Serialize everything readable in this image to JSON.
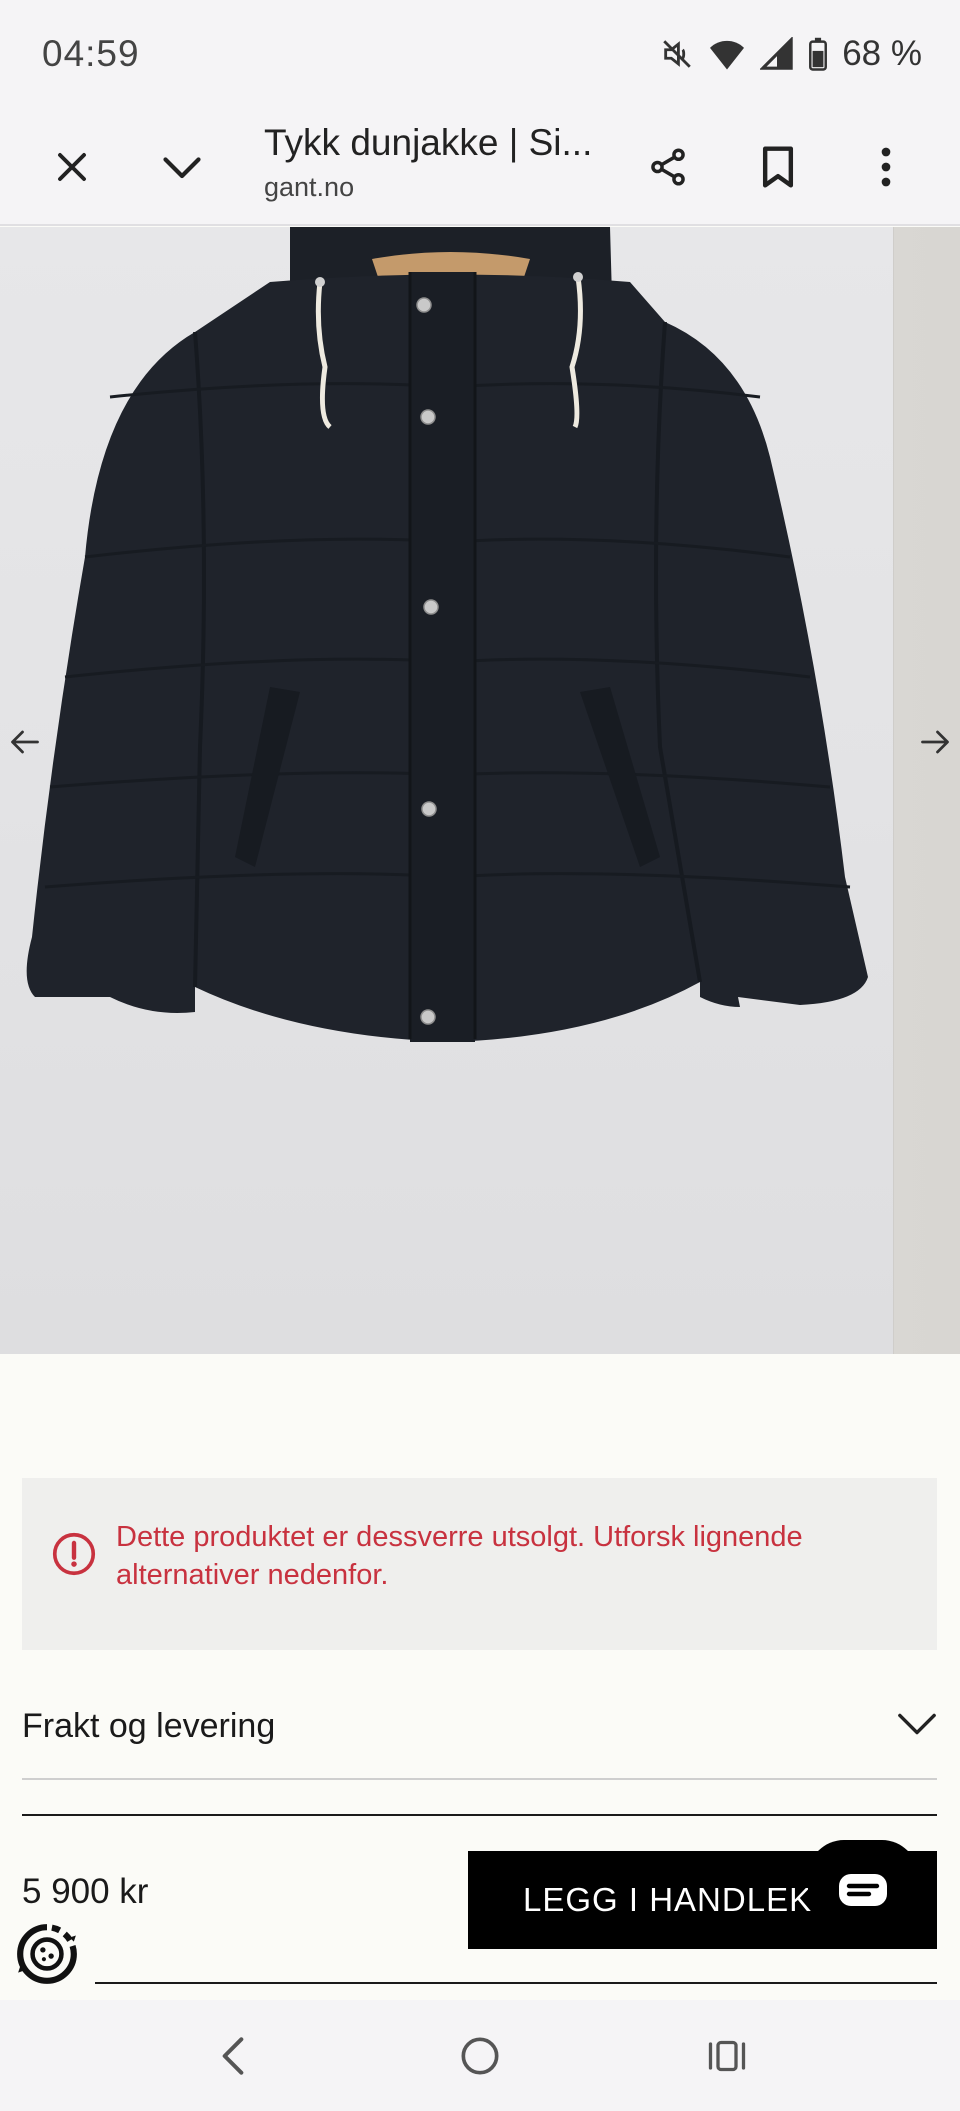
{
  "status_bar": {
    "time": "04:59",
    "battery": "68 %",
    "icons": [
      "mute-icon",
      "wifi-icon",
      "signal-icon",
      "battery-icon"
    ]
  },
  "toolbar": {
    "title": "Tykk dunjakke | Si...",
    "url": "gant.no",
    "icons": [
      "close-icon",
      "chevron-down-icon",
      "share-icon",
      "bookmark-icon",
      "more-icon"
    ]
  },
  "gallery": {
    "image_alt": "Tykk dunjakke",
    "prev_icon": "arrow-left-icon",
    "next_icon": "arrow-right-icon"
  },
  "notice": {
    "message": "Dette produktet er dessverre utsolgt. Utforsk lignende alternativer nedenfor.",
    "icon": "alert-icon",
    "color": "#c8323f"
  },
  "accordion": {
    "label": "Frakt og levering"
  },
  "buy": {
    "price": "5 900 kr",
    "button_label": "LEGG I HANDLEKURV",
    "chat_icon": "chat-icon",
    "cookie_icon": "cookie-settings-icon"
  },
  "navbar": {
    "icons": [
      "back-icon",
      "home-icon",
      "recents-icon"
    ]
  }
}
